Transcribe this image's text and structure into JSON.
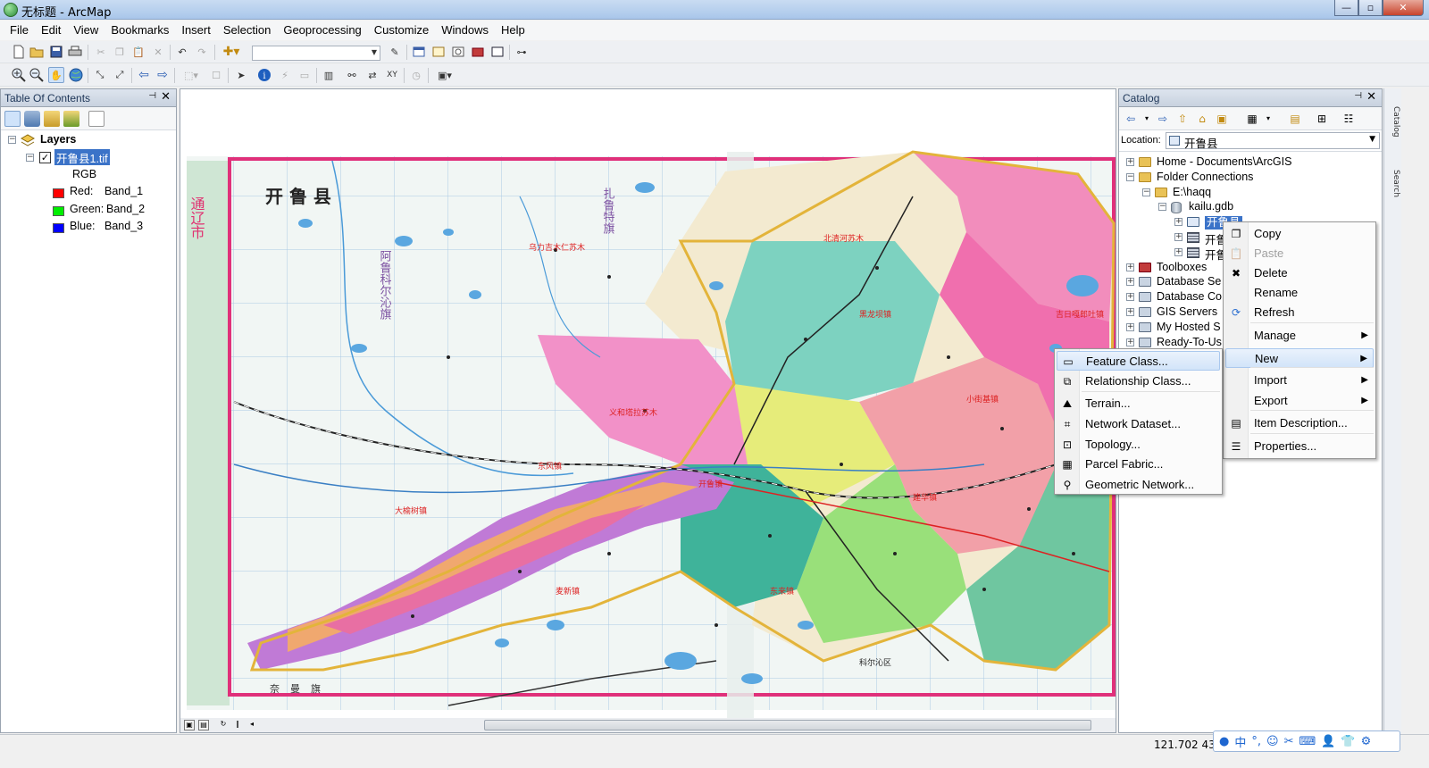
{
  "window": {
    "title": "无标题 - ArcMap",
    "min": "—",
    "max": "▫",
    "close": "✕"
  },
  "menu": [
    "File",
    "Edit",
    "View",
    "Bookmarks",
    "Insert",
    "Selection",
    "Geoprocessing",
    "Customize",
    "Windows",
    "Help"
  ],
  "toc": {
    "title": "Table Of Contents",
    "layers_label": "Layers",
    "layer_name": "开鲁县1.tif",
    "render_type": "RGB",
    "bands": [
      {
        "channel": "Red:",
        "band": "Band_1",
        "color": "#ff0000"
      },
      {
        "channel": "Green:",
        "band": "Band_2",
        "color": "#00ee00"
      },
      {
        "channel": "Blue:",
        "band": "Band_3",
        "color": "#0000ff"
      }
    ]
  },
  "map": {
    "county_title": "开 鲁 县",
    "neighbor_city": "通辽市",
    "place_labels": [
      "乌力吉木仁苏木",
      "扎鲁特旗",
      "阿鲁科尔沁旗",
      "义和塔拉苏木",
      "东风镇",
      "大榆树镇",
      "麦新镇",
      "开鲁镇",
      "北清河苏木",
      "小街基镇",
      "黑龙坝镇",
      "建华镇",
      "吉日嘎郎吐镇",
      "东来镇",
      "科尔沁区",
      "奈曼旗"
    ]
  },
  "catalog": {
    "title": "Catalog",
    "location_label": "Location:",
    "location_value": "开鲁县",
    "tree": [
      {
        "label": "Home - Documents\\ArcGIS",
        "indent": 0,
        "expander": "+",
        "icon": "folder"
      },
      {
        "label": "Folder Connections",
        "indent": 0,
        "expander": "−",
        "icon": "folder"
      },
      {
        "label": "E:\\haqq",
        "indent": 1,
        "expander": "−",
        "icon": "folder"
      },
      {
        "label": "kailu.gdb",
        "indent": 2,
        "expander": "−",
        "icon": "gdb"
      },
      {
        "label": "开鲁县",
        "indent": 3,
        "expander": "+",
        "icon": "dataset",
        "selected": true
      },
      {
        "label": "开鲁县",
        "indent": 3,
        "expander": "+",
        "icon": "raster"
      },
      {
        "label": "开鲁县",
        "indent": 3,
        "expander": "+",
        "icon": "raster"
      },
      {
        "label": "Toolboxes",
        "indent": 0,
        "expander": "+",
        "icon": "toolbox"
      },
      {
        "label": "Database Se",
        "indent": 0,
        "expander": "+",
        "icon": "server"
      },
      {
        "label": "Database Co",
        "indent": 0,
        "expander": "+",
        "icon": "server"
      },
      {
        "label": "GIS Servers",
        "indent": 0,
        "expander": "+",
        "icon": "server"
      },
      {
        "label": "My Hosted S",
        "indent": 0,
        "expander": "+",
        "icon": "server"
      },
      {
        "label": "Ready-To-Us",
        "indent": 0,
        "expander": "+",
        "icon": "server"
      }
    ]
  },
  "sidetabs": [
    "Catalog",
    "Search"
  ],
  "context_menu": {
    "items": [
      {
        "label": "Copy",
        "icon": "copy-icon",
        "disabled": false
      },
      {
        "label": "Paste",
        "icon": "paste-icon",
        "disabled": true
      },
      {
        "label": "Delete",
        "icon": "delete-icon",
        "disabled": false
      },
      {
        "label": "Rename",
        "icon": "",
        "disabled": false
      },
      {
        "label": "Refresh",
        "icon": "refresh-icon",
        "disabled": false
      },
      {
        "label": "Manage",
        "icon": "",
        "submenu": true
      },
      {
        "label": "New",
        "icon": "",
        "submenu": true,
        "highlight": true
      },
      {
        "label": "Import",
        "icon": "",
        "submenu": true
      },
      {
        "label": "Export",
        "icon": "",
        "submenu": true
      },
      {
        "label": "Item Description...",
        "icon": "description-icon"
      },
      {
        "label": "Properties...",
        "icon": "properties-icon"
      }
    ]
  },
  "new_submenu": {
    "items": [
      {
        "label": "Feature Class...",
        "icon": "feature-class-icon",
        "highlight": true
      },
      {
        "label": "Relationship Class...",
        "icon": "relationship-class-icon"
      },
      {
        "label": "Terrain...",
        "icon": "terrain-icon"
      },
      {
        "label": "Network Dataset...",
        "icon": "network-dataset-icon"
      },
      {
        "label": "Topology...",
        "icon": "topology-icon"
      },
      {
        "label": "Parcel Fabric...",
        "icon": "parcel-fabric-icon"
      },
      {
        "label": "Geometric Network...",
        "icon": "geometric-network-icon"
      }
    ]
  },
  "status": {
    "coords": "121.702  43"
  },
  "ime": [
    "中",
    "°,",
    "☺",
    "✂",
    "⌨",
    "👤",
    "👕",
    "⚙"
  ]
}
